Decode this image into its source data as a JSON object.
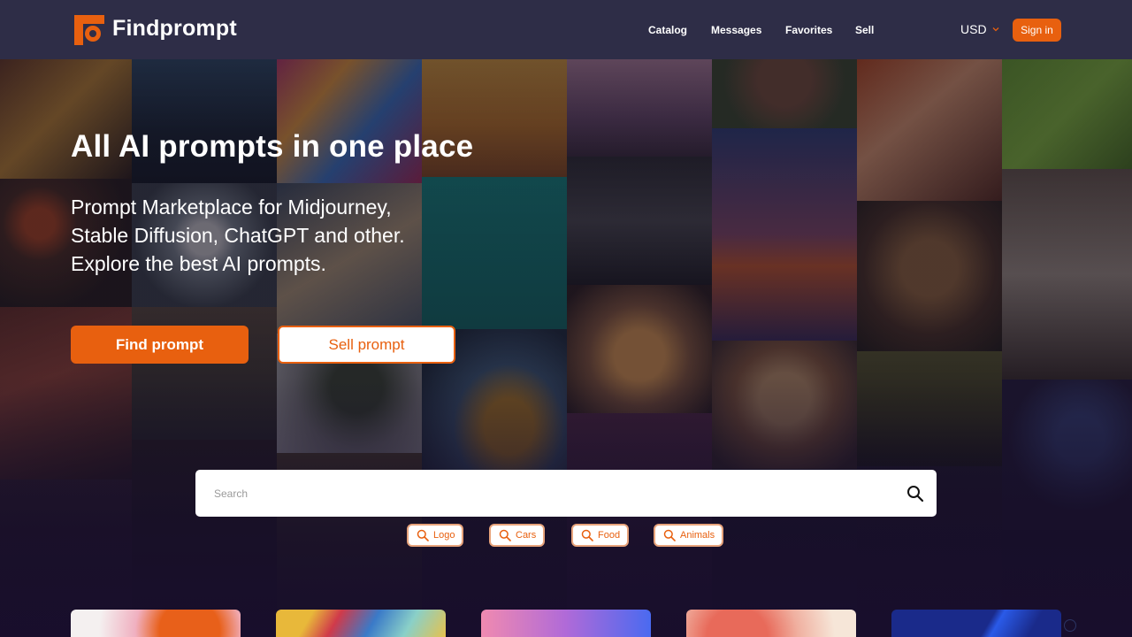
{
  "header": {
    "logo_text": "Findprompt",
    "nav": [
      {
        "label": "Catalog"
      },
      {
        "label": "Messages"
      },
      {
        "label": "Favorites"
      },
      {
        "label": "Sell"
      }
    ],
    "currency": "USD",
    "sign_in_label": "Sign in"
  },
  "hero": {
    "title": "All AI prompts in one place",
    "subtitle_lines": [
      "Prompt Marketplace for Midjourney,",
      "Stable Diffusion, ChatGPT and other.",
      "Explore the best AI prompts."
    ],
    "find_button": "Find prompt",
    "sell_button": "Sell prompt"
  },
  "search": {
    "placeholder": "Search",
    "value": ""
  },
  "tags": [
    {
      "label": "Logo",
      "icon": "search-icon"
    },
    {
      "label": "Cars",
      "icon": "search-icon"
    },
    {
      "label": "Food",
      "icon": "search-icon"
    },
    {
      "label": "Animals",
      "icon": "search-icon"
    }
  ],
  "colors": {
    "accent": "#e8600f",
    "header_bg": "#2e2d47",
    "page_bg": "#1e1a2e"
  }
}
